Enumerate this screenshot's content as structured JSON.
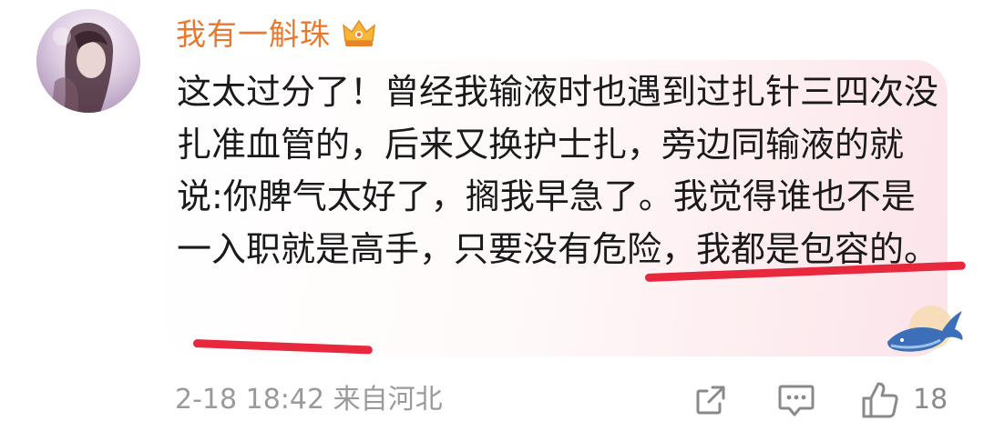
{
  "comment": {
    "username": "我有一斛珠",
    "badge_icon": "crown-icon",
    "text": "这太过分了！曾经我输液时也遇到过扎针三四次没扎准血管的，后来又换护士扎，旁边同输液的就说:你脾气太好了，搁我早急了。我觉得谁也不是一入职就是高手，只要没有危险，我都是包容的。",
    "highlighted": [
      "只要没有危险，我",
      "都是包容的"
    ],
    "timestamp": "2-18 18:42",
    "location": "来自河北",
    "like_count": "18"
  },
  "colors": {
    "username": "#e8782b",
    "highlight_underline": "#e8283c",
    "meta_text": "#9a9a9a",
    "bubble_tint": "#fbe4ea"
  },
  "actions": {
    "share_icon": "share-icon",
    "reply_icon": "reply-icon",
    "like_icon": "thumbs-up-icon"
  }
}
